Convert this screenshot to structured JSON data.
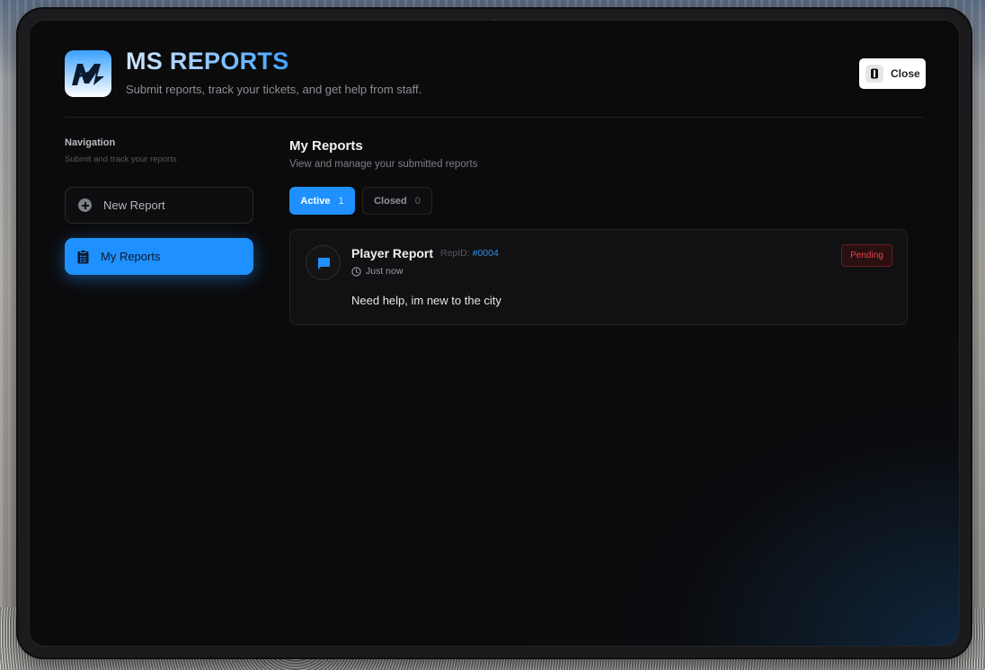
{
  "app": {
    "title": "MS REPORTS",
    "subtitle": "Submit reports, track your tickets, and get help from staff.",
    "close_label": "Close",
    "accent_color": "#1e90ff"
  },
  "sidebar": {
    "title": "Navigation",
    "subtitle": "Submit and track your reports",
    "items": [
      {
        "label": "New Report",
        "icon": "plus-circle-icon",
        "active": false
      },
      {
        "label": "My Reports",
        "icon": "clipboard-icon",
        "active": true
      }
    ]
  },
  "main": {
    "title": "My Reports",
    "subtitle": "View and manage your submitted reports",
    "tabs": [
      {
        "label": "Active",
        "count": "1",
        "active": true
      },
      {
        "label": "Closed",
        "count": "0",
        "active": false
      }
    ],
    "reports": [
      {
        "title": "Player Report",
        "repid_label": "RepID:",
        "repid": "#0004",
        "time": "Just now",
        "message": "Need help, im new to the city",
        "status": "Pending",
        "status_color": "#e0434a",
        "icon": "chat-bubble-icon"
      }
    ]
  }
}
